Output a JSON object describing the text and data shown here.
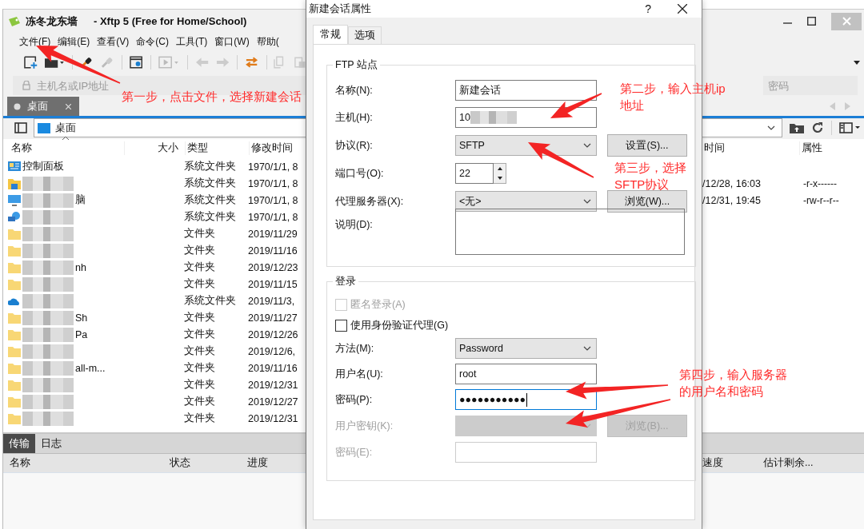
{
  "window": {
    "title": "冻冬龙东墙",
    "app_title": "- Xftp 5 (Free for Home/School)"
  },
  "menu": [
    "文件(F)",
    "编辑(E)",
    "查看(V)",
    "命令(C)",
    "工具(T)",
    "窗口(W)",
    "帮助("
  ],
  "address": {
    "host_placeholder": "主机名或IP地址",
    "password_placeholder": "密码"
  },
  "tabs": [
    {
      "label": "桌面",
      "selected": true
    }
  ],
  "path": "桌面",
  "left_pane": {
    "columns": [
      "名称",
      "大小",
      "类型",
      "修改时间"
    ],
    "rows": [
      {
        "kind": "control",
        "name": "控制面板",
        "type": "系统文件夹",
        "modified": "1970/1/1, 8"
      },
      {
        "kind": "user",
        "blurred": true,
        "type": "系统文件夹",
        "modified": "1970/1/1, 8"
      },
      {
        "kind": "computer",
        "name": "脑",
        "blurred": true,
        "type": "系统文件夹",
        "modified": "1970/1/1, 8"
      },
      {
        "kind": "network",
        "blurred": true,
        "type": "系统文件夹",
        "modified": "1970/1/1, 8"
      },
      {
        "kind": "folder",
        "blurred": true,
        "type": "文件夹",
        "modified": "2019/11/29"
      },
      {
        "kind": "folder",
        "blurred": true,
        "type": "文件夹",
        "modified": "2019/11/16"
      },
      {
        "kind": "folder",
        "name": "nh",
        "blurred": true,
        "type": "文件夹",
        "modified": "2019/12/23"
      },
      {
        "kind": "folder",
        "blurred": true,
        "type": "文件夹",
        "modified": "2019/11/15"
      },
      {
        "kind": "cloud",
        "blurred": true,
        "type": "系统文件夹",
        "modified": "2019/11/3,"
      },
      {
        "kind": "folder",
        "name": "Sh",
        "blurred": true,
        "type": "文件夹",
        "modified": "2019/11/27"
      },
      {
        "kind": "folder",
        "name": "Pa",
        "blurred": true,
        "type": "文件夹",
        "modified": "2019/12/26"
      },
      {
        "kind": "folder",
        "blurred": true,
        "type": "文件夹",
        "modified": "2019/12/6,"
      },
      {
        "kind": "folder",
        "name": "all-m...",
        "blurred": true,
        "type": "文件夹",
        "modified": "2019/11/16"
      },
      {
        "kind": "folder",
        "blurred": true,
        "type": "文件夹",
        "modified": "2019/12/31"
      },
      {
        "kind": "folder",
        "blurred": true,
        "type": "文件夹",
        "modified": "2019/12/27"
      },
      {
        "kind": "folder",
        "blurred": true,
        "type": "文件夹",
        "modified": "2019/12/31"
      }
    ]
  },
  "right_pane": {
    "columns": [
      "时间",
      "属性"
    ],
    "rows": [
      {
        "modified": "/12/28, 16:03",
        "attributes": "-r-x------"
      },
      {
        "modified": "/12/31, 19:45",
        "attributes": "-rw-r--r--"
      }
    ]
  },
  "transfer": {
    "tabs": [
      {
        "label": "传输",
        "selected": true
      },
      {
        "label": "日志",
        "selected": false
      }
    ],
    "columns_left": [
      "名称",
      "状态",
      "进度"
    ],
    "columns_right": [
      "速度",
      "估计剩余..."
    ]
  },
  "dialog": {
    "title": "新建会话属性",
    "help": "?",
    "tabs": [
      {
        "label": "常规",
        "selected": true
      },
      {
        "label": "选项",
        "selected": false
      }
    ],
    "groups": [
      {
        "title": "FTP 站点",
        "rows": [
          {
            "kind": "text",
            "label": "名称(N):",
            "value": "新建会话",
            "disabled": false,
            "focused": false
          },
          {
            "kind": "text",
            "label": "主机(H):",
            "value": "10",
            "blurred": true,
            "disabled": false,
            "focused": false
          },
          {
            "kind": "select",
            "label": "协议(R):",
            "value": "SFTP",
            "button": "设置(S)...",
            "disabled": false
          },
          {
            "kind": "spin",
            "label": "端口号(O):",
            "value": "22",
            "disabled": false
          },
          {
            "kind": "select",
            "label": "代理服务器(X):",
            "value": "<无>",
            "button": "浏览(W)...",
            "disabled": false
          },
          {
            "kind": "textarea",
            "label": "说明(D):",
            "disabled": false
          }
        ]
      },
      {
        "title": "登录",
        "rows": [
          {
            "kind": "checkbox",
            "label": "匿名登录(A)",
            "checked": false,
            "disabled": true
          },
          {
            "kind": "checkbox",
            "label": "使用身份验证代理(G)",
            "checked": false,
            "disabled": false
          },
          {
            "kind": "select",
            "label": "方法(M):",
            "value": "Password",
            "disabled": false
          },
          {
            "kind": "text",
            "label": "用户名(U):",
            "value": "root",
            "disabled": false,
            "focused": false
          },
          {
            "kind": "text",
            "label": "密码(P):",
            "value": "●●●●●●●●●●●",
            "disabled": false,
            "focused": true
          },
          {
            "kind": "select",
            "label": "用户密钥(K):",
            "button": "浏览(B)...",
            "disabled": true
          },
          {
            "kind": "text",
            "label": "密码(E):",
            "disabled": true,
            "focused": false
          }
        ]
      }
    ]
  },
  "annotations": [
    {
      "lines": [
        "第一步，点击文件，选择新建会话"
      ]
    },
    {
      "lines": [
        "第二步，输入主机ip",
        "地址"
      ]
    },
    {
      "lines": [
        "第三步，选择",
        "SFTP协议"
      ]
    },
    {
      "lines": [
        "第四步，输入服务器",
        "的用户名和密码"
      ]
    }
  ]
}
